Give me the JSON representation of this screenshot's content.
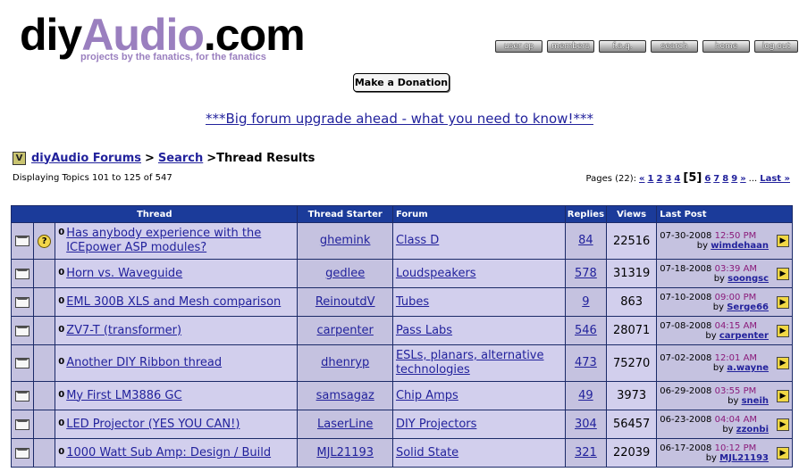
{
  "header": {
    "logo_part1": "diy",
    "logo_part2": "Audio",
    "logo_part3": ".com",
    "tagline": "projects by the fanatics, for the fanatics",
    "nav": [
      "user cp",
      "members",
      "f.a.q.",
      "search",
      "home",
      "log out"
    ]
  },
  "donate_label": "Make a Donation",
  "announcement": "***Big forum upgrade ahead - what you need to know!***",
  "breadcrumb": {
    "forums": "diyAudio Forums",
    "sep": ">",
    "search": "Search",
    "current": ">Thread Results"
  },
  "displaying": "Displaying Topics 101 to 125 of 547",
  "pagination": {
    "label": "Pages (22):",
    "first": "«",
    "pages": [
      "1",
      "2",
      "3",
      "4"
    ],
    "current": "[5]",
    "after": [
      "6",
      "7",
      "8",
      "9"
    ],
    "next": "»",
    "ellipsis": "...",
    "last": "Last »"
  },
  "table": {
    "headers": {
      "thread": "Thread",
      "starter": "Thread Starter",
      "forum": "Forum",
      "replies": "Replies",
      "views": "Views",
      "last_post": "Last Post"
    },
    "rows": [
      {
        "title": "Has anybody experience with the ICEpower ASP modules?",
        "starter": "ghemink",
        "forum": "Class D",
        "replies": "84",
        "views": "22516",
        "date": "07-30-2008",
        "time": "12:50 PM",
        "by": "by",
        "user": "wimdehaan",
        "question": true
      },
      {
        "title": "Horn vs. Waveguide",
        "starter": "gedlee",
        "forum": "Loudspeakers",
        "replies": "578",
        "views": "31319",
        "date": "07-18-2008",
        "time": "03:39 AM",
        "by": "by",
        "user": "soongsc",
        "question": false
      },
      {
        "title": "EML 300B XLS and Mesh comparison",
        "starter": "ReinoutdV",
        "forum": "Tubes",
        "replies": "9",
        "views": "863",
        "date": "07-10-2008",
        "time": "09:00 PM",
        "by": "by",
        "user": "Serge66",
        "question": false
      },
      {
        "title": "ZV7-T (transformer)",
        "starter": "carpenter",
        "forum": "Pass Labs",
        "replies": "546",
        "views": "28071",
        "date": "07-08-2008",
        "time": "04:15 AM",
        "by": "by",
        "user": "carpenter",
        "question": false
      },
      {
        "title": "Another DIY Ribbon thread",
        "starter": "dhenryp",
        "forum": "ESLs, planars, alternative technologies",
        "replies": "473",
        "views": "75270",
        "date": "07-02-2008",
        "time": "12:01 AM",
        "by": "by",
        "user": "a.wayne",
        "question": false
      },
      {
        "title": "My First LM3886 GC",
        "starter": "samsagaz",
        "forum": "Chip Amps",
        "replies": "49",
        "views": "3973",
        "date": "06-29-2008",
        "time": "03:55 PM",
        "by": "by",
        "user": "sneih",
        "question": false
      },
      {
        "title": "LED Projector (YES YOU CAN!)",
        "starter": "LaserLine",
        "forum": "DIY Projectors",
        "replies": "304",
        "views": "56457",
        "date": "06-23-2008",
        "time": "04:04 AM",
        "by": "by",
        "user": "zzonbi",
        "question": false
      },
      {
        "title": "1000 Watt Sub Amp: Design / Build",
        "starter": "MJL21193",
        "forum": "Solid State",
        "replies": "321",
        "views": "22039",
        "date": "06-17-2008",
        "time": "10:12 PM",
        "by": "by",
        "user": "MJL21193",
        "question": false
      }
    ]
  }
}
